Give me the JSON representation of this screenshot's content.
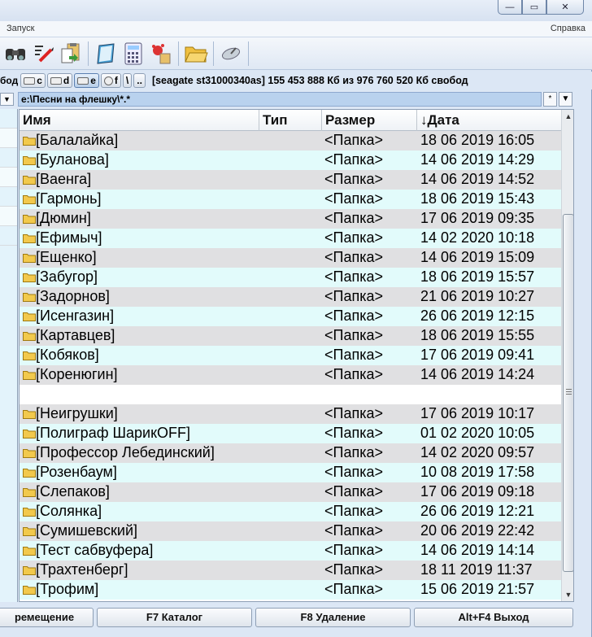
{
  "menu": {
    "left": "Запуск",
    "right": "Справка"
  },
  "window_buttons": {
    "minimize": "—",
    "maximize": "▭",
    "close": "✕"
  },
  "drivebar": {
    "cut_label": "бод",
    "drives": [
      {
        "letter": "c",
        "active": false
      },
      {
        "letter": "d",
        "active": false
      },
      {
        "letter": "e",
        "active": true
      },
      {
        "letter": "f",
        "active": false
      }
    ],
    "root": "\\",
    "up": "..",
    "disk_info": "[seagate st31000340as]  155 453 888 Кб из 976 760 520 Кб свобод"
  },
  "path": {
    "value": "e:\\Песни на флешку\\*.*",
    "left_btn": "▼",
    "star_btn": "*",
    "dropdown_btn": "▼"
  },
  "columns": {
    "name": "Имя",
    "type": "Тип",
    "size": "Размер",
    "date": "Дата",
    "sort_arrow": "↓"
  },
  "rows": [
    {
      "name": "[Балалайка]",
      "size": "<Папка>",
      "date": "18 06 2019 16:05"
    },
    {
      "name": "[Буланова]",
      "size": "<Папка>",
      "date": "14 06 2019 14:29"
    },
    {
      "name": "[Ваенга]",
      "size": "<Папка>",
      "date": "14 06 2019 14:52"
    },
    {
      "name": "[Гармонь]",
      "size": "<Папка>",
      "date": "18 06 2019 15:43"
    },
    {
      "name": "[Дюмин]",
      "size": "<Папка>",
      "date": "17 06 2019 09:35"
    },
    {
      "name": "[Ефимыч]",
      "size": "<Папка>",
      "date": "14 02 2020 10:18"
    },
    {
      "name": "[Ещенко]",
      "size": "<Папка>",
      "date": "14 06 2019 15:09"
    },
    {
      "name": "[Забугор]",
      "size": "<Папка>",
      "date": "18 06 2019 15:57"
    },
    {
      "name": "[Задорнов]",
      "size": "<Папка>",
      "date": "21 06 2019 10:27"
    },
    {
      "name": "[Исенгазин]",
      "size": "<Папка>",
      "date": "26 06 2019 12:15"
    },
    {
      "name": "[Картавцев]",
      "size": "<Папка>",
      "date": "18 06 2019 15:55"
    },
    {
      "name": "[Кобяков]",
      "size": "<Папка>",
      "date": "17 06 2019 09:41"
    },
    {
      "name": "[Коренюгин]",
      "size": "<Папка>",
      "date": "14 06 2019 14:24"
    },
    {
      "name": "",
      "size": "",
      "date": ""
    },
    {
      "name": "[Неигрушки]",
      "size": "<Папка>",
      "date": "17 06 2019 10:17"
    },
    {
      "name": "[Полиграф ШарикOFF]",
      "size": "<Папка>",
      "date": "01 02 2020 10:05"
    },
    {
      "name": "[Профессор Лебединский]",
      "size": "<Папка>",
      "date": "14 02 2020 09:57"
    },
    {
      "name": "[Розенбаум]",
      "size": "<Папка>",
      "date": "10 08 2019 17:58"
    },
    {
      "name": "[Слепаков]",
      "size": "<Папка>",
      "date": "17 06 2019 09:18"
    },
    {
      "name": "[Солянка]",
      "size": "<Папка>",
      "date": "26 06 2019 12:21"
    },
    {
      "name": "[Сумишевский]",
      "size": "<Папка>",
      "date": "20 06 2019 22:42"
    },
    {
      "name": "[Тест сабвуфера]",
      "size": "<Папка>",
      "date": "14 06 2019 14:14"
    },
    {
      "name": "[Трахтенберг]",
      "size": "<Папка>",
      "date": "18 11 2019 11:37"
    },
    {
      "name": "[Трофим]",
      "size": "<Папка>",
      "date": "15 06 2019 21:57"
    }
  ],
  "fkeys": [
    "ремещение",
    "F7 Каталог",
    "F8 Удаление",
    "Alt+F4 Выход"
  ],
  "colors": {
    "row_odd": "#e0e0e2",
    "row_even": "#e2fbfb",
    "path_bg": "#b9d2ee",
    "folder": "#f2c94c"
  }
}
